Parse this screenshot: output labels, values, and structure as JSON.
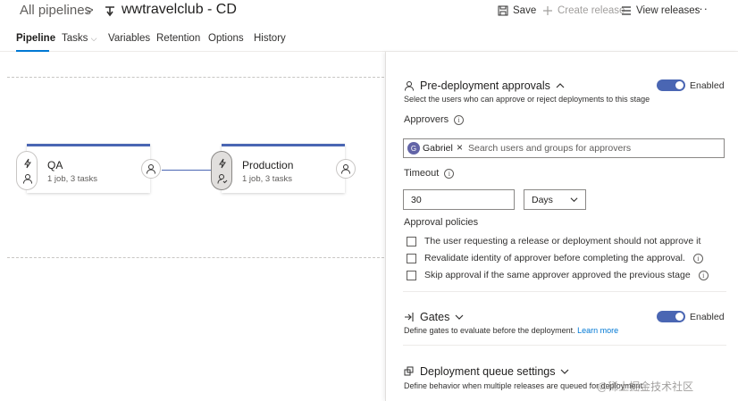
{
  "breadcrumb": {
    "root": "All pipelines",
    "separator": ">",
    "title": "wwtravelclub - CD"
  },
  "header_actions": {
    "save": "Save",
    "create_release": "Create release",
    "view_releases": "View releases",
    "more": "···"
  },
  "tabs": [
    {
      "label": "Pipeline",
      "active": true
    },
    {
      "label": "Tasks",
      "active": false
    },
    {
      "label": "Variables",
      "active": false
    },
    {
      "label": "Retention",
      "active": false
    },
    {
      "label": "Options",
      "active": false
    },
    {
      "label": "History",
      "active": false
    }
  ],
  "stages": [
    {
      "name": "QA",
      "summary": "1 job, 3 tasks"
    },
    {
      "name": "Production",
      "summary": "1 job, 3 tasks"
    }
  ],
  "pre_deployment": {
    "title": "Pre-deployment approvals",
    "toggle_label": "Enabled",
    "description": "Select the users who can approve or reject deployments to this stage",
    "approvers_label": "Approvers",
    "approver": {
      "initial": "G",
      "name": "Gabriel"
    },
    "search_placeholder": "Search users and groups for approvers",
    "timeout_label": "Timeout",
    "timeout_value": "30",
    "timeout_unit": "Days",
    "policies_label": "Approval policies",
    "policies": [
      {
        "label": "The user requesting a release or deployment should not approve it",
        "checked": false
      },
      {
        "label": "Revalidate identity of approver before completing the approval.",
        "checked": false
      },
      {
        "label": "Skip approval if the same approver approved the previous stage",
        "checked": false
      }
    ]
  },
  "gates": {
    "title": "Gates",
    "toggle_label": "Enabled",
    "description": "Define gates to evaluate before the deployment.",
    "learn_more": "Learn more"
  },
  "queue": {
    "title": "Deployment queue settings",
    "description": "Define behavior when multiple releases are queued for deployment"
  },
  "watermark": "@稀土掘金技术社区",
  "colors": {
    "accent": "#0078d4",
    "stage_bar": "#4a66b3",
    "toggle_on": "#4a66b3"
  }
}
